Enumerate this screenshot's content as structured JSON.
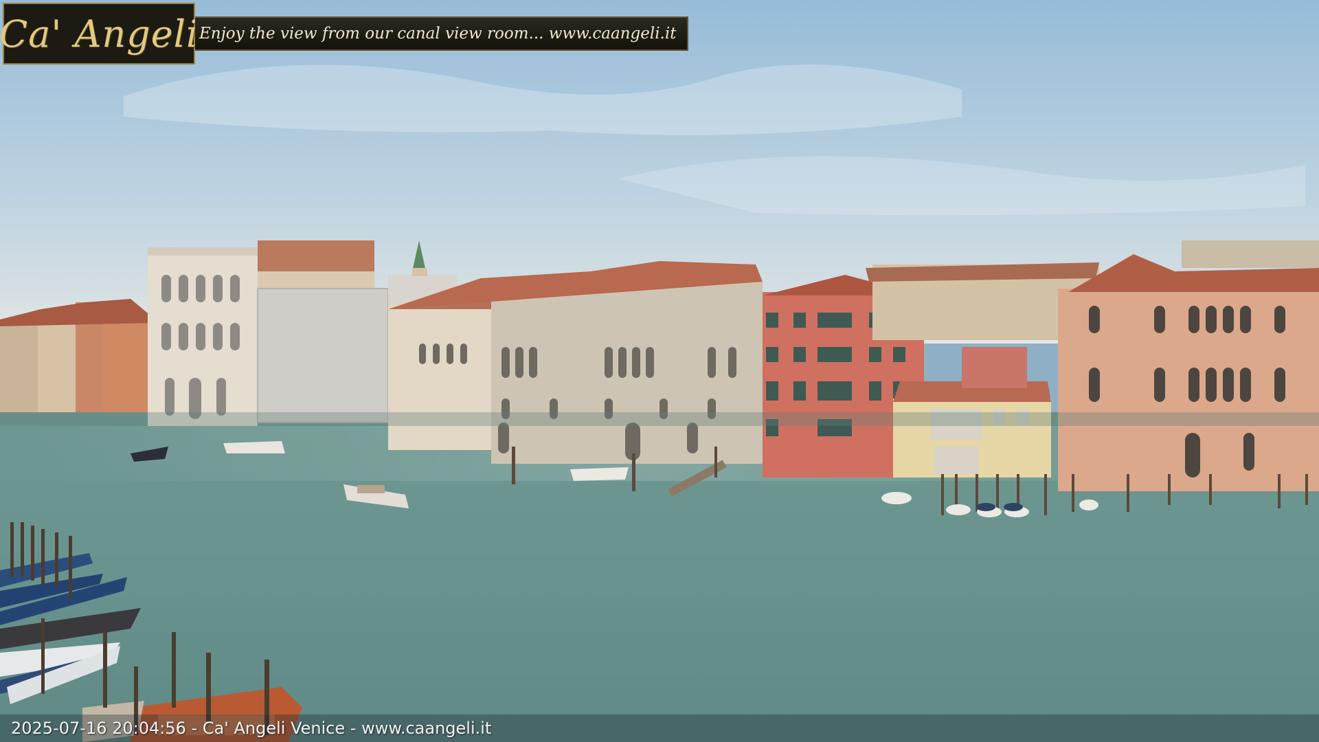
{
  "overlay": {
    "logo": "Ca' Angeli",
    "tagline": "Enjoy the view from our canal view room... www.caangeli.it",
    "footer": "2025-07-16 20:04:56 - Ca' Angeli Venice - www.caangeli.it"
  },
  "colors": {
    "sky_top": "#9cc0dc",
    "sky_bottom": "#dde6ea",
    "water": "#6f9a94",
    "logo_gold": "#e1c980",
    "banner_dark": "#1c1a13"
  }
}
